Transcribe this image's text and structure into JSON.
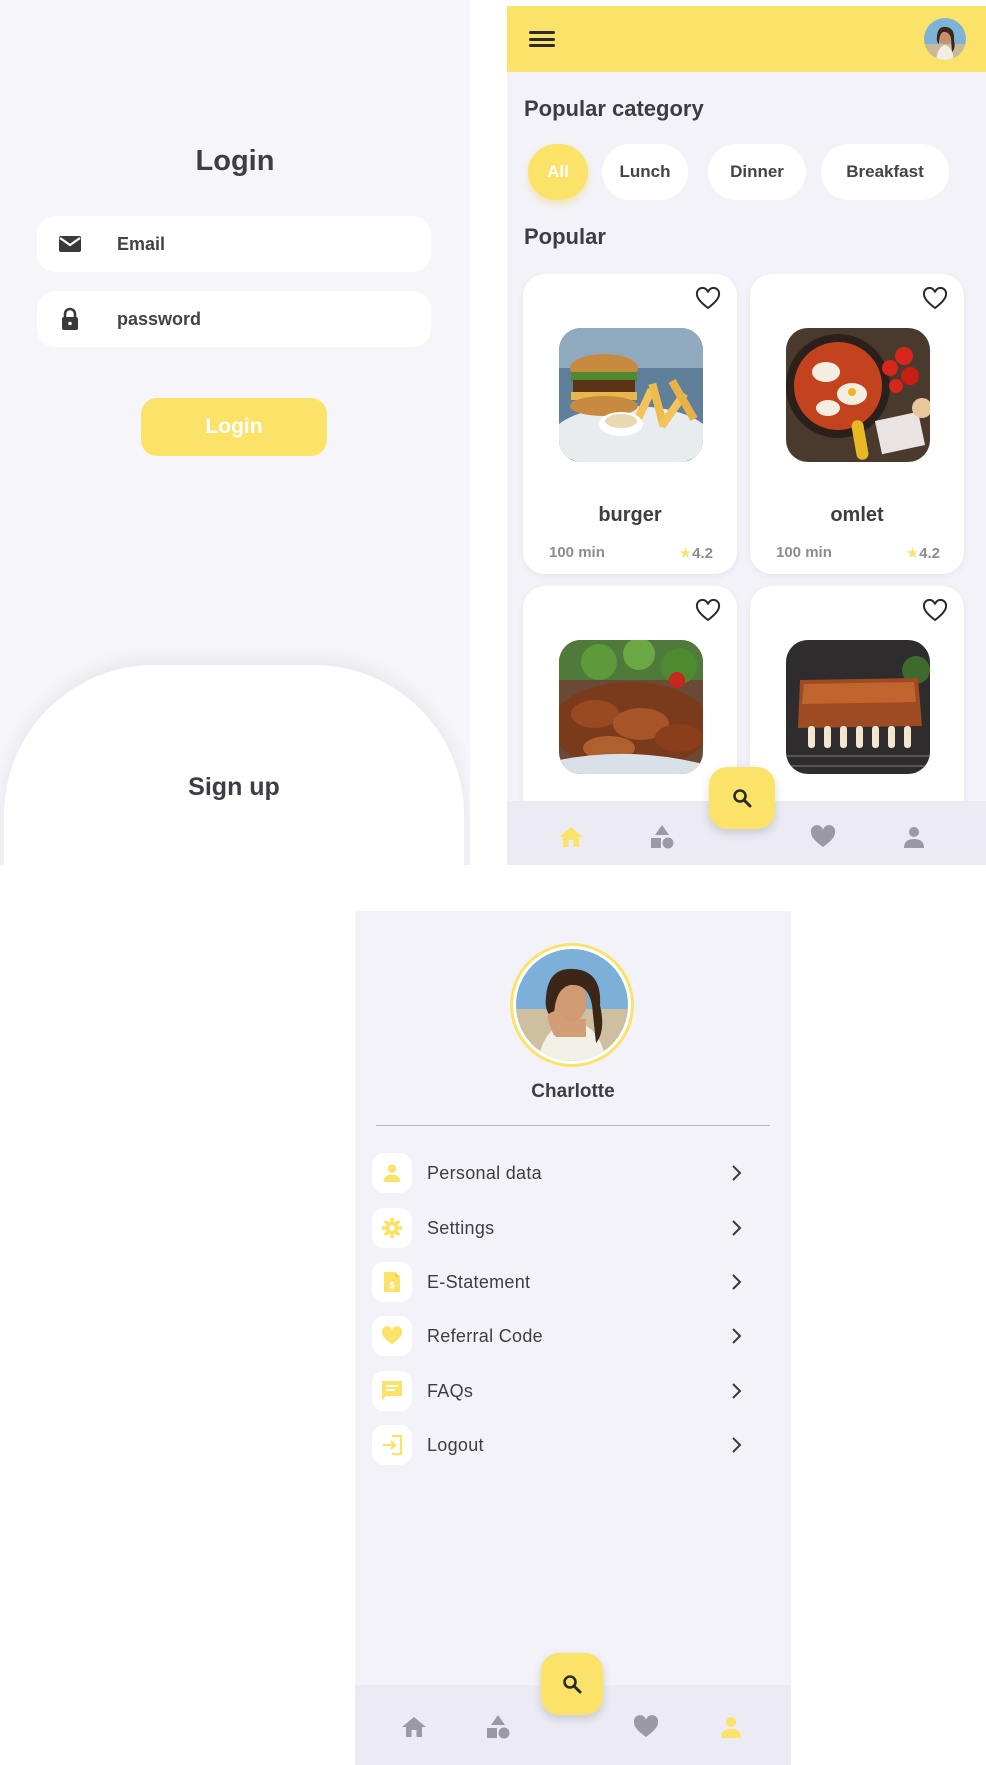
{
  "colors": {
    "accent": "#fbe36a",
    "background": "#f3f2f8",
    "text": "#3d3d46",
    "muted": "#8c8c94"
  },
  "login": {
    "title": "Login",
    "email_placeholder": "Email",
    "password_placeholder": "password",
    "login_button": "Login",
    "signup_label": "Sign up"
  },
  "home": {
    "popular_category_title": "Popular category",
    "categories": [
      "All",
      "Lunch",
      "Dinner",
      "Breakfast"
    ],
    "selected_category": "All",
    "popular_title": "Popular",
    "foods": [
      {
        "name": "burger",
        "time": "100 min",
        "rating": "4.2",
        "image": "burger-photo"
      },
      {
        "name": "omlet",
        "time": "100 min",
        "rating": "4.2",
        "image": "omelet-photo"
      },
      {
        "name": "",
        "time": "",
        "rating": "",
        "image": "chicken-photo"
      },
      {
        "name": "",
        "time": "",
        "rating": "",
        "image": "ribs-photo"
      }
    ],
    "nav": [
      "home-icon",
      "categories-icon",
      "search-icon",
      "heart-icon",
      "person-icon"
    ],
    "active_nav": "home-icon"
  },
  "profile": {
    "name": "Charlotte",
    "menu": [
      {
        "label": "Personal data",
        "icon": "person-icon"
      },
      {
        "label": "Settings",
        "icon": "gear-icon"
      },
      {
        "label": "E-Statement",
        "icon": "document-icon"
      },
      {
        "label": "Referral Code",
        "icon": "heart-icon"
      },
      {
        "label": "FAQs",
        "icon": "chat-icon"
      },
      {
        "label": "Logout",
        "icon": "logout-icon"
      }
    ],
    "active_nav": "person-icon"
  }
}
